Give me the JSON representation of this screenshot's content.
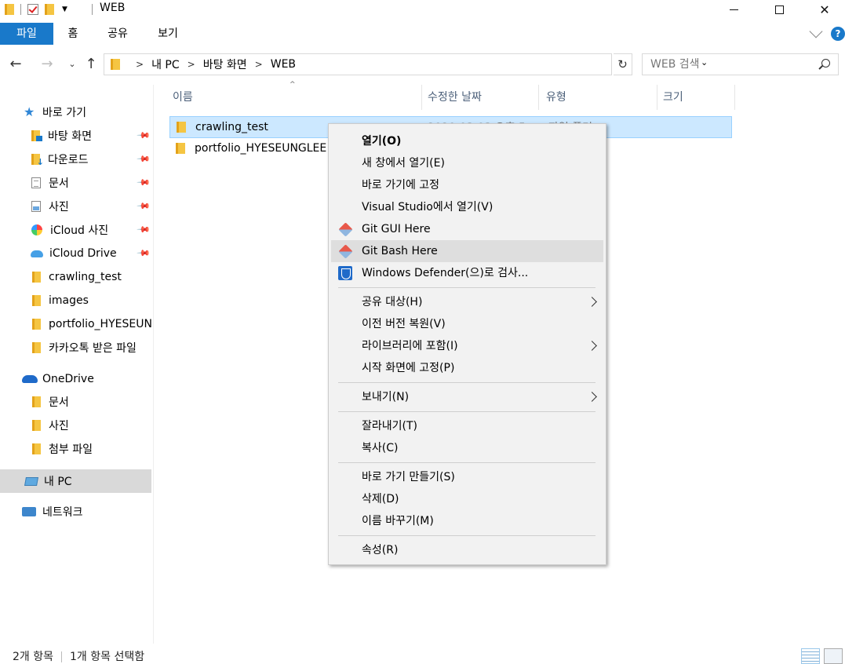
{
  "window": {
    "title": "WEB",
    "help": "?"
  },
  "ribbon": {
    "tabs": [
      "파일",
      "홈",
      "공유",
      "보기"
    ]
  },
  "address": {
    "crumbs": [
      "내 PC",
      "바탕 화면",
      "WEB"
    ],
    "search_placeholder": "WEB 검색"
  },
  "nav": {
    "items": [
      {
        "label": "바로 가기",
        "icon": "star-icon"
      },
      {
        "label": "바탕 화면",
        "icon": "desktop-folder-icon",
        "pinned": true
      },
      {
        "label": "다운로드",
        "icon": "download-folder-icon",
        "pinned": true
      },
      {
        "label": "문서",
        "icon": "document-icon",
        "pinned": true
      },
      {
        "label": "사진",
        "icon": "picture-icon",
        "pinned": true
      },
      {
        "label": "iCloud 사진",
        "icon": "icloud-photos-icon",
        "pinned": true
      },
      {
        "label": "iCloud Drive",
        "icon": "icloud-drive-icon",
        "pinned": true
      },
      {
        "label": "crawling_test",
        "icon": "folder-icon"
      },
      {
        "label": "images",
        "icon": "folder-icon"
      },
      {
        "label": "portfolio_HYESEUN",
        "icon": "folder-icon"
      },
      {
        "label": "카카오톡 받은 파일",
        "icon": "folder-icon"
      },
      {
        "label": "OneDrive",
        "icon": "onedrive-icon"
      },
      {
        "label": "문서",
        "icon": "folder-icon"
      },
      {
        "label": "사진",
        "icon": "folder-icon"
      },
      {
        "label": "첨부 파일",
        "icon": "folder-icon"
      },
      {
        "label": "내 PC",
        "icon": "pc-icon",
        "selected": true
      },
      {
        "label": "네트워크",
        "icon": "network-icon"
      }
    ]
  },
  "filelist": {
    "columns": [
      "이름",
      "수정한 날짜",
      "유형",
      "크기"
    ],
    "rows": [
      {
        "name": "crawling_test",
        "date": "2020-03-03 오후 5...",
        "type": "파일 폴더",
        "selected": true
      },
      {
        "name": "portfolio_HYESEUNGLEE",
        "date": "",
        "type": ""
      }
    ]
  },
  "context_menu": {
    "items": [
      {
        "label": "열기(O)",
        "bold": true
      },
      {
        "label": "새 창에서 열기(E)"
      },
      {
        "label": "바로 가기에 고정"
      },
      {
        "label": "Visual Studio에서 열기(V)"
      },
      {
        "label": "Git GUI Here",
        "icon": "git-icon"
      },
      {
        "label": "Git Bash Here",
        "icon": "git-icon",
        "hover": true
      },
      {
        "label": "Windows Defender(으)로 검사...",
        "icon": "windows-defender-icon"
      },
      {
        "label": "공유 대상(H)",
        "submenu": true
      },
      {
        "label": "이전 버전 복원(V)"
      },
      {
        "label": "라이브러리에 포함(I)",
        "submenu": true
      },
      {
        "label": "시작 화면에 고정(P)"
      },
      {
        "label": "보내기(N)",
        "submenu": true
      },
      {
        "label": "잘라내기(T)"
      },
      {
        "label": "복사(C)"
      },
      {
        "label": "바로 가기 만들기(S)"
      },
      {
        "label": "삭제(D)"
      },
      {
        "label": "이름 바꾸기(M)"
      },
      {
        "label": "속성(R)"
      }
    ]
  },
  "status": {
    "count": "2개 항목",
    "selected": "1개 항목 선택함"
  },
  "colors": {
    "accent": "#1979ca",
    "selection": "#cce8ff",
    "menu_bg": "#f2f2f2",
    "menu_hover": "#dedede"
  }
}
